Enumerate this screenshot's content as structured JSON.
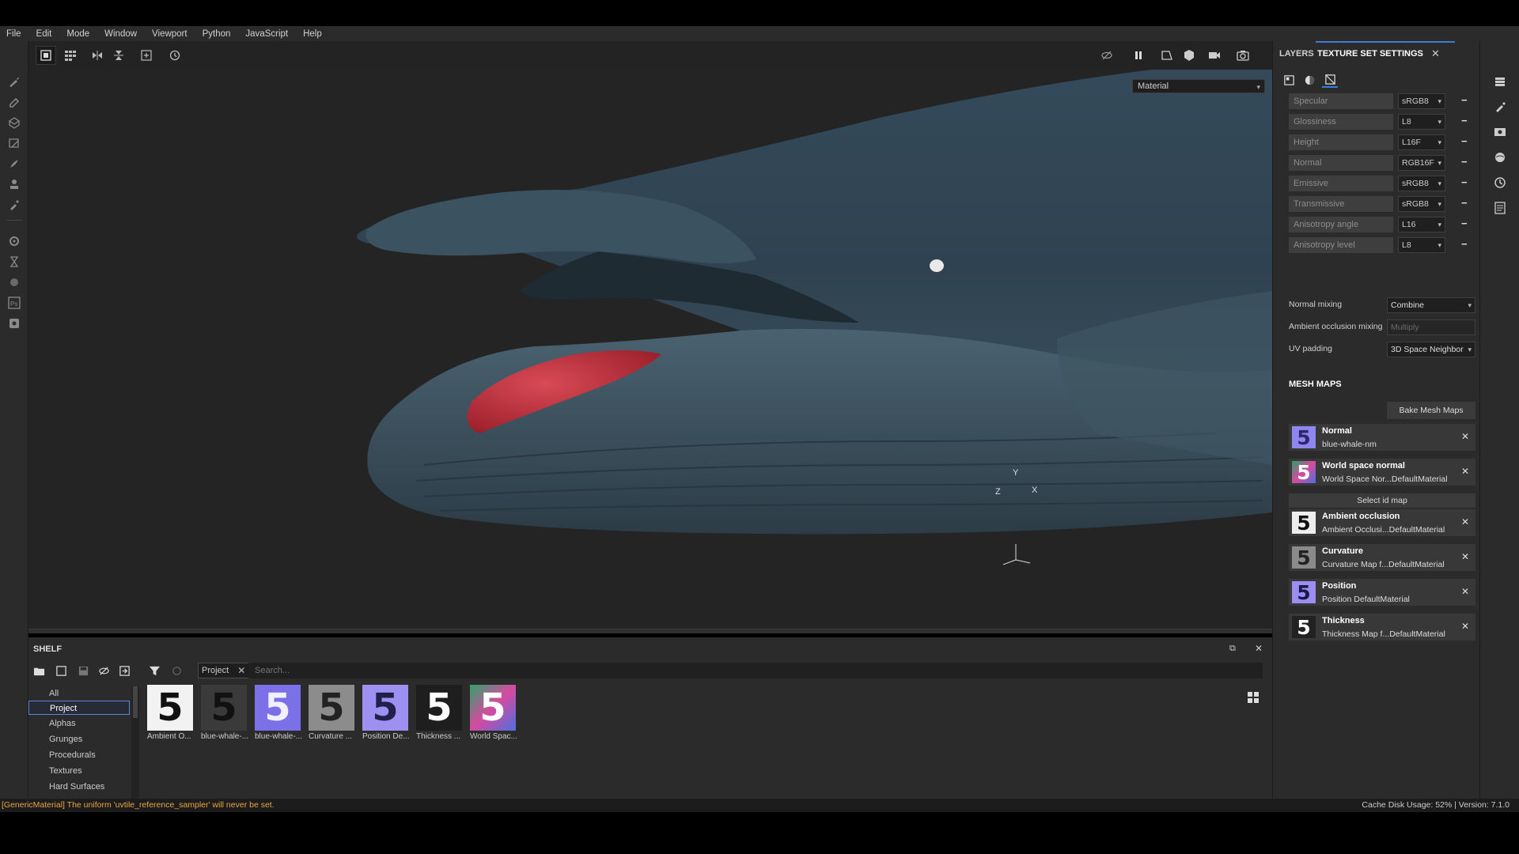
{
  "menu": [
    "File",
    "Edit",
    "Mode",
    "Window",
    "Viewport",
    "Python",
    "JavaScript",
    "Help"
  ],
  "viewport": {
    "material_mode": "Material",
    "axis_labels": {
      "x": "X",
      "y": "Y",
      "z": "Z"
    }
  },
  "right_panel": {
    "tabs": {
      "layers": "LAYERS",
      "texture_set_settings": "TEXTURE SET SETTINGS"
    },
    "close": "✕",
    "channels": [
      {
        "name": "Specular",
        "format": "sRGB8"
      },
      {
        "name": "Glossiness",
        "format": "L8"
      },
      {
        "name": "Height",
        "format": "L16F"
      },
      {
        "name": "Normal",
        "format": "RGB16F"
      },
      {
        "name": "Emissive",
        "format": "sRGB8"
      },
      {
        "name": "Transmissive",
        "format": "sRGB8"
      },
      {
        "name": "Anisotropy angle",
        "format": "L16"
      },
      {
        "name": "Anisotropy level",
        "format": "L8"
      }
    ],
    "normal_mixing": {
      "label": "Normal mixing",
      "value": "Combine"
    },
    "ao_mixing": {
      "label": "Ambient occlusion mixing",
      "value": "Multiply"
    },
    "uv_padding": {
      "label": "UV padding",
      "value": "3D Space Neighbor"
    },
    "mesh_maps_title": "MESH MAPS",
    "bake_button": "Bake Mesh Maps",
    "select_id_map": "Select id map",
    "mesh_maps": [
      {
        "name": "Normal",
        "file": "blue-whale-nm",
        "thumb_color": "#7b6de8",
        "thumb_bg": "#8f86f0"
      },
      {
        "name": "World space normal",
        "file": "World Space Nor...DefaultMaterial",
        "thumb_color": "#ffffff",
        "thumb_bg": "#2aa06a"
      },
      {
        "name": "Ambient occlusion",
        "file": "Ambient Occlusi...DefaultMaterial",
        "thumb_color": "#111111",
        "thumb_bg": "#eeeeee"
      },
      {
        "name": "Curvature",
        "file": "Curvature Map f...DefaultMaterial",
        "thumb_color": "#222222",
        "thumb_bg": "#8a8a8a"
      },
      {
        "name": "Position",
        "file": "Position DefaultMaterial",
        "thumb_color": "#1a1a4a",
        "thumb_bg": "#9c8ef0"
      },
      {
        "name": "Thickness",
        "file": "Thickness Map f...DefaultMaterial",
        "thumb_color": "#ffffff",
        "thumb_bg": "#222222"
      }
    ]
  },
  "shelf": {
    "title": "SHELF",
    "project_chip": "Project",
    "search_placeholder": "Search...",
    "categories": [
      "All",
      "Project",
      "Alphas",
      "Grunges",
      "Procedurals",
      "Textures",
      "Hard Surfaces"
    ],
    "selected_category": "Project",
    "items": [
      {
        "label": "Ambient O...",
        "fg": "#111111",
        "bg": "#f2f2f2"
      },
      {
        "label": "blue-whale-...",
        "fg": "#111111",
        "bg": "#3a3a3a"
      },
      {
        "label": "blue-whale-...",
        "fg": "#f0f0ff",
        "bg": "#7b70e8"
      },
      {
        "label": "Curvature ...",
        "fg": "#222222",
        "bg": "#8c8c8c"
      },
      {
        "label": "Position De...",
        "fg": "#20204a",
        "bg": "#9d90f0"
      },
      {
        "label": "Thickness ...",
        "fg": "#ffffff",
        "bg": "#1e1e1e"
      },
      {
        "label": "World Spac...",
        "fg": "#ffffff",
        "bg": "#2ea46a"
      }
    ]
  },
  "status": {
    "message": "[GenericMaterial] The uniform 'uvtile_reference_sampler' will never be set.",
    "right": "Cache Disk Usage:    52% | Version: 7.1.0"
  },
  "colors": {
    "accent": "#3d7bd6",
    "warning": "#e8a640",
    "whale": "#2f4250",
    "tongue": "#c0313c"
  }
}
